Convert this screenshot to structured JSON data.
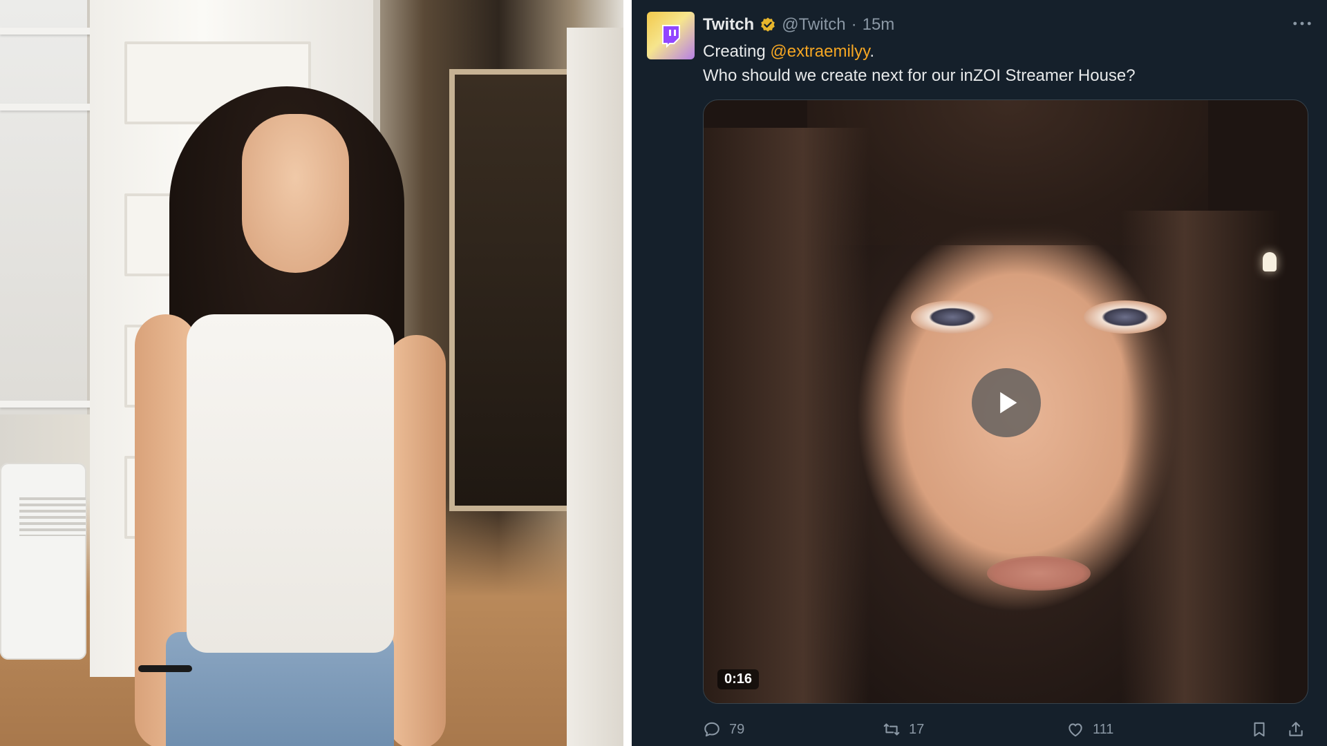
{
  "tweet": {
    "display_name": "Twitch",
    "handle": "@Twitch",
    "separator": "·",
    "time_ago": "15m",
    "text_prefix": "Creating ",
    "mention": "@extraemilyy",
    "text_suffix": ".",
    "text_line2": "Who should we create next for our inZOI Streamer House?",
    "media": {
      "duration": "0:16"
    },
    "stats": {
      "replies": "79",
      "retweets": "17",
      "likes": "111"
    }
  },
  "colors": {
    "background": "#15202b",
    "text_primary": "#e7e9ea",
    "text_secondary": "#8b98a5",
    "mention": "#f5a623",
    "verified_badge": "#e8b62c"
  },
  "icons": {
    "avatar": "twitch-logo-icon",
    "verified": "verified-badge-icon",
    "more": "more-options-icon",
    "play": "play-icon",
    "reply": "reply-icon",
    "retweet": "retweet-icon",
    "like": "heart-icon",
    "bookmark": "bookmark-icon",
    "share": "share-icon"
  }
}
